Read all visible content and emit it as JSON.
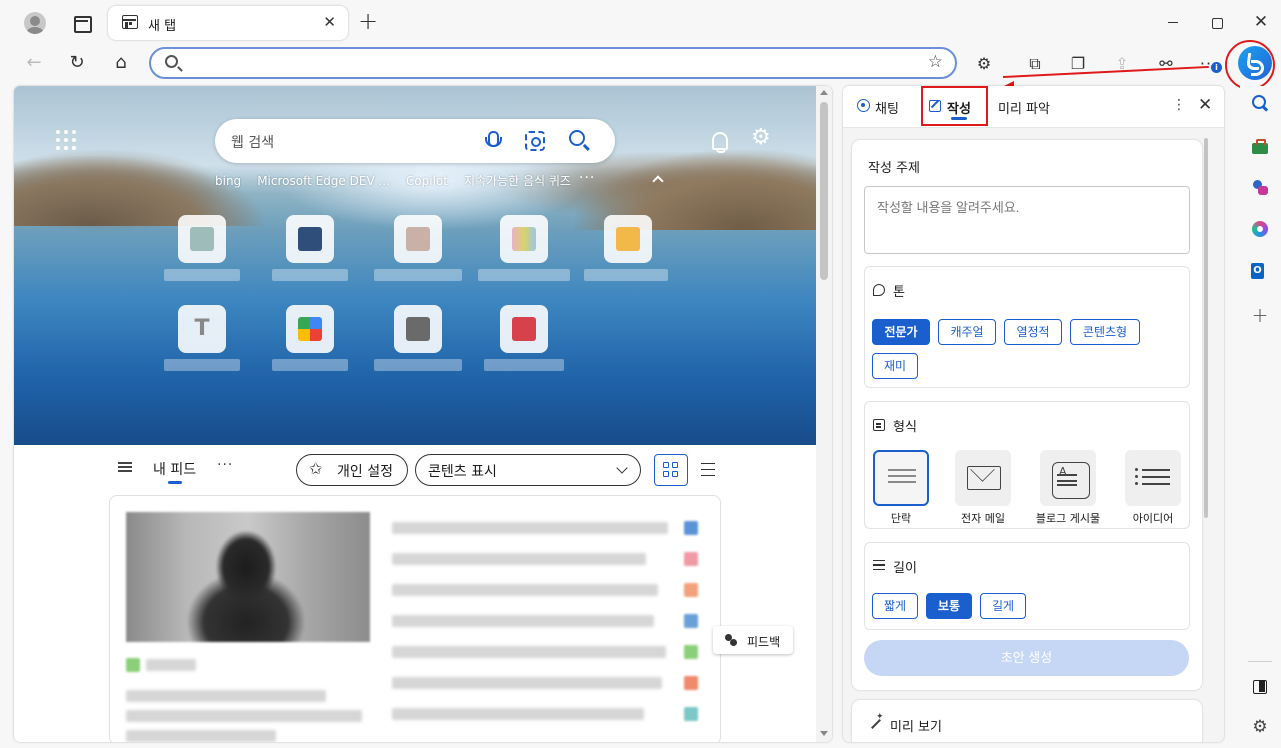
{
  "tab": {
    "title": "새 탭",
    "close": "✕"
  },
  "window": {
    "close": "✕"
  },
  "address": {
    "value": "",
    "placeholder": ""
  },
  "toolbar": {
    "more": "···"
  },
  "hero": {
    "search_placeholder": "웹 검색",
    "quick_links": [
      "bing",
      "Microsoft Edge DEV ...",
      "Copilot",
      "지속가능한 음식 퀴즈"
    ],
    "quick_links_more": "···",
    "settings": "⚙"
  },
  "feed": {
    "title": "내 피드",
    "more": "···",
    "personalize": "개인 설정",
    "content_view": "콘텐츠 표시",
    "feedback": "피드백"
  },
  "copilot": {
    "tabs": {
      "chat": "채팅",
      "compose": "작성",
      "insights": "미리 파악"
    },
    "more": "⋮",
    "close": "✕",
    "topic_heading": "작성 주제",
    "topic_placeholder": "작성할 내용을 알려주세요.",
    "tone": {
      "title": "톤",
      "options": [
        "전문가",
        "캐주얼",
        "열정적",
        "콘텐츠형",
        "재미"
      ],
      "selected": "전문가"
    },
    "format": {
      "title": "형식",
      "options": [
        "단락",
        "전자 메일",
        "블로그 게시물",
        "아이디어"
      ],
      "selected": "단락"
    },
    "length": {
      "title": "길이",
      "options": [
        "짧게",
        "보통",
        "길게"
      ],
      "selected": "보통"
    },
    "generate": "초안 생성",
    "preview": "미리 보기"
  },
  "colors": {
    "accent": "#1b5fcf",
    "annotation": "#e0191a",
    "generate_disabled": "#c6d6f5"
  }
}
